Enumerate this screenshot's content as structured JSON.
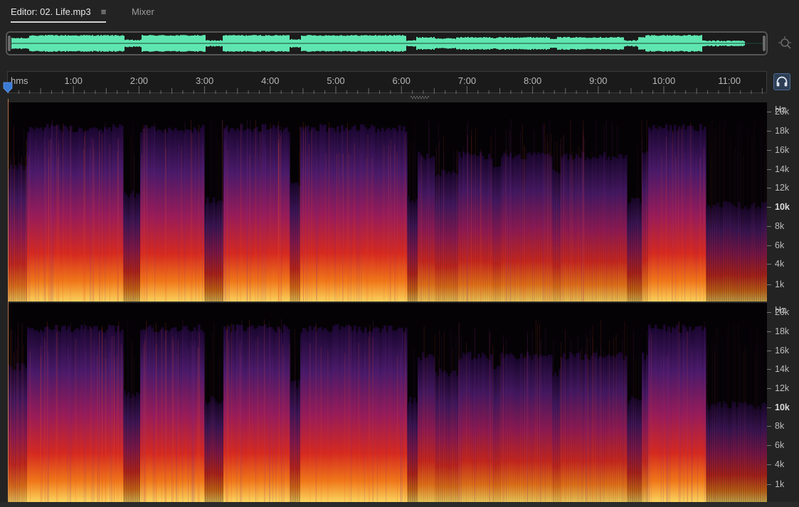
{
  "tabs": {
    "editor_label": "Editor: 02. Life.mp3",
    "menu_glyph": "≡",
    "mixer_label": "Mixer"
  },
  "colors": {
    "overview_wave": "#5fe6b0",
    "accent": "#3a7bd5",
    "playhead": "#e0905a"
  },
  "icons": {
    "zoom": "zoom-to-fit-icon",
    "headphones": "headphones-icon",
    "menu": "panel-menu-icon"
  },
  "ruler": {
    "unit": "hms",
    "total_seconds": 695,
    "labels": [
      {
        "t": 60,
        "text": "1:00"
      },
      {
        "t": 120,
        "text": "2:00"
      },
      {
        "t": 180,
        "text": "3:00"
      },
      {
        "t": 240,
        "text": "4:00"
      },
      {
        "t": 300,
        "text": "5:00"
      },
      {
        "t": 360,
        "text": "6:00"
      },
      {
        "t": 420,
        "text": "7:00"
      },
      {
        "t": 480,
        "text": "8:00"
      },
      {
        "t": 540,
        "text": "9:00"
      },
      {
        "t": 600,
        "text": "10:00"
      },
      {
        "t": 660,
        "text": "11:00"
      }
    ]
  },
  "frequency_scale": {
    "unit": "Hz",
    "max_hz": 21000,
    "labels": [
      {
        "hz": 20000,
        "text": "20k",
        "bold": false
      },
      {
        "hz": 18000,
        "text": "18k",
        "bold": false
      },
      {
        "hz": 16000,
        "text": "16k",
        "bold": false
      },
      {
        "hz": 14000,
        "text": "14k",
        "bold": false
      },
      {
        "hz": 12000,
        "text": "12k",
        "bold": false
      },
      {
        "hz": 10000,
        "text": "10k",
        "bold": true
      },
      {
        "hz": 8000,
        "text": "8k",
        "bold": false
      },
      {
        "hz": 6000,
        "text": "6k",
        "bold": false
      },
      {
        "hz": 4000,
        "text": "4k",
        "bold": false
      },
      {
        "hz": 1000,
        "text": "1k",
        "bold": false
      }
    ]
  },
  "channels": [
    "left",
    "right"
  ]
}
